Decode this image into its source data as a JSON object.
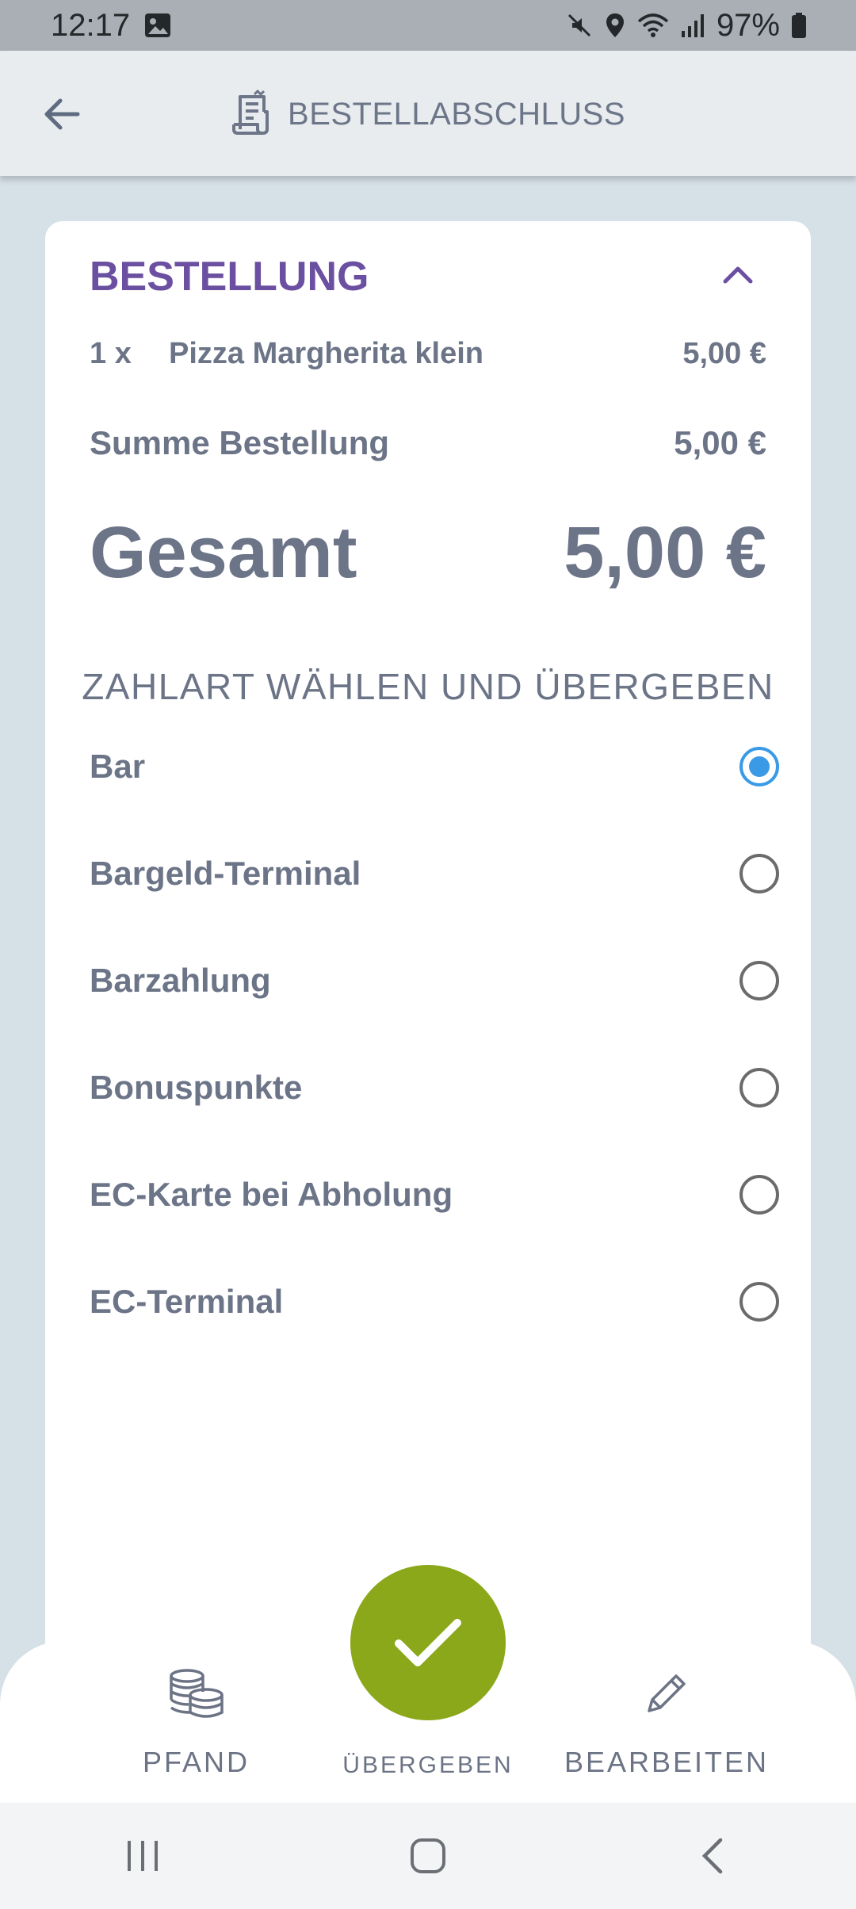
{
  "status_bar": {
    "time": "12:17",
    "battery": "97%"
  },
  "header": {
    "title": "BESTELLABSCHLUSS"
  },
  "order": {
    "section_title": "BESTELLUNG",
    "items": [
      {
        "qty": "1 x",
        "name": "Pizza Margherita klein",
        "price": "5,00 €"
      }
    ],
    "sum_label": "Summe Bestellung",
    "sum_value": "5,00 €",
    "total_label": "Gesamt",
    "total_value": "5,00 €"
  },
  "payment": {
    "heading": "ZAHLART WÄHLEN UND ÜBERGEBEN",
    "options": [
      {
        "label": "Bar",
        "selected": true
      },
      {
        "label": "Bargeld-Terminal",
        "selected": false
      },
      {
        "label": "Barzahlung",
        "selected": false
      },
      {
        "label": "Bonuspunkte",
        "selected": false
      },
      {
        "label": "EC-Karte bei Abholung",
        "selected": false
      },
      {
        "label": "EC-Terminal",
        "selected": false
      }
    ]
  },
  "bottom_nav": {
    "left_label": "PFAND",
    "center_label": "ÜBERGEBEN",
    "right_label": "BEARBEITEN"
  },
  "colors": {
    "accent_purple": "#6b4fa0",
    "confirm_green": "#8aa81a",
    "radio_blue": "#3a9ae6",
    "text_gray": "#6c7487",
    "background": "#d5e0e7"
  },
  "icons": {
    "back": "arrow-left-icon",
    "receipt": "receipt-icon",
    "collapse": "chevron-up-icon",
    "pfand": "coins-icon",
    "confirm": "check-icon",
    "edit": "pencil-icon"
  }
}
